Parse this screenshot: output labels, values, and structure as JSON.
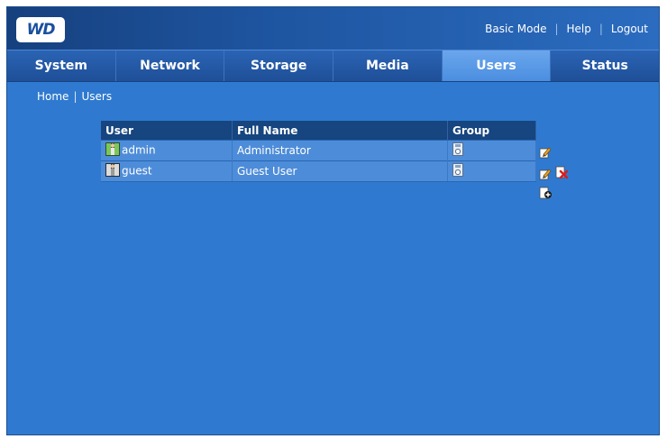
{
  "header": {
    "logo_text": "WD",
    "links": {
      "basic_mode": "Basic Mode",
      "help": "Help",
      "logout": "Logout"
    }
  },
  "nav": {
    "tabs": [
      {
        "label": "System"
      },
      {
        "label": "Network"
      },
      {
        "label": "Storage"
      },
      {
        "label": "Media"
      },
      {
        "label": "Users",
        "active": true
      },
      {
        "label": "Status"
      }
    ]
  },
  "breadcrumb": {
    "home": "Home",
    "separator": "|",
    "current": "Users"
  },
  "users_table": {
    "headers": {
      "user": "User",
      "full_name": "Full Name",
      "group": "Group"
    },
    "rows": [
      {
        "user": "admin",
        "full_name": "Administrator"
      },
      {
        "user": "guest",
        "full_name": "Guest User"
      }
    ]
  },
  "icons": {
    "admin_user": "admin-user-icon",
    "guest_user": "user-icon",
    "group": "group-icon",
    "edit": "edit-icon",
    "delete": "delete-icon",
    "add": "add-user-icon"
  },
  "colors": {
    "background": "#2f7ad0",
    "header_dark": "#16407e",
    "active_tab": "#5a9be6",
    "table_header": "#16457f",
    "table_row": "#4d8cd8"
  }
}
